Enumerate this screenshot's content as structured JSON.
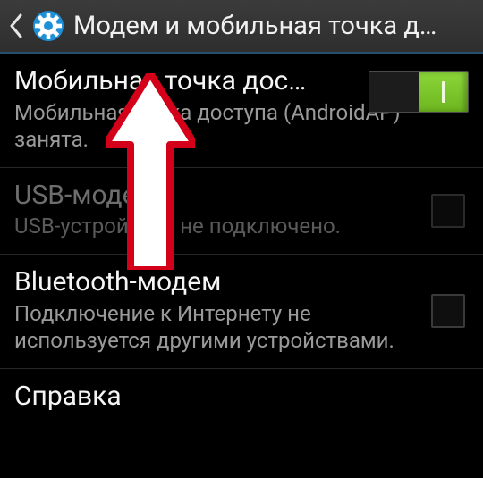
{
  "actionbar": {
    "title": "Модем и мобильная точка д…"
  },
  "items": [
    {
      "title": "Мобильная точка дос…",
      "subtitle": "Мобильная точка доступа (AndroidAP) занята.",
      "toggle_on": true
    },
    {
      "title": "USB-модем",
      "subtitle": "USB-устройство не подключено."
    },
    {
      "title": "Bluetooth-модем",
      "subtitle": "Подключение к Интернету не используется другими устройствами."
    },
    {
      "title": "Справка"
    }
  ]
}
